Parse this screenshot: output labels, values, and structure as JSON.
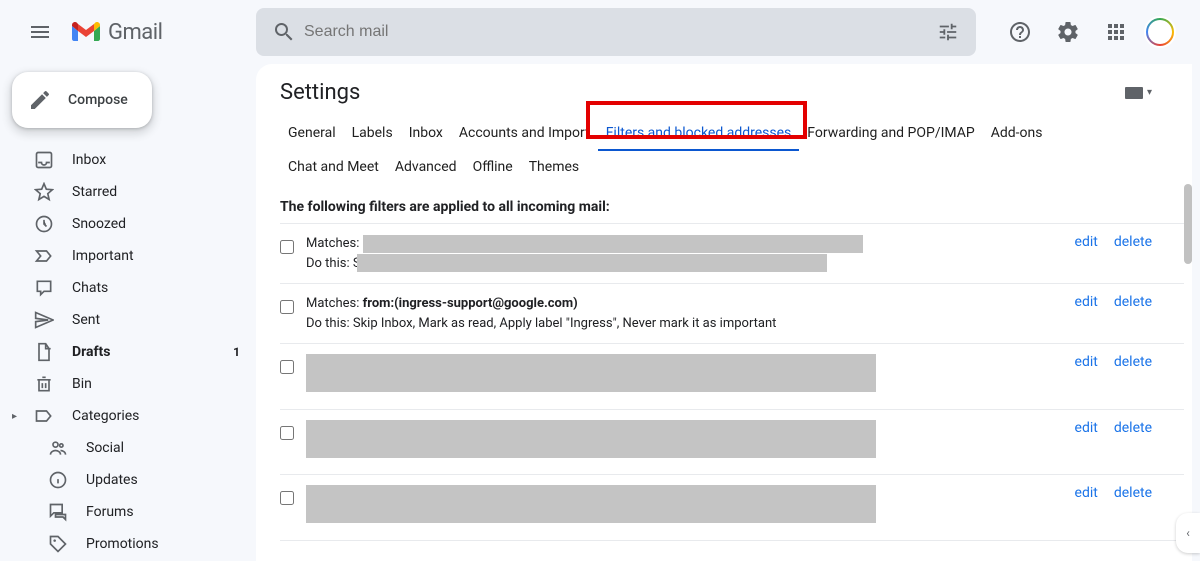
{
  "header": {
    "app_name": "Gmail",
    "search_placeholder": "Search mail"
  },
  "sidebar": {
    "compose_label": "Compose",
    "items": [
      {
        "icon": "inbox",
        "label": "Inbox",
        "bold": false
      },
      {
        "icon": "star",
        "label": "Starred",
        "bold": false
      },
      {
        "icon": "clock",
        "label": "Snoozed",
        "bold": false
      },
      {
        "icon": "important",
        "label": "Important",
        "bold": false
      },
      {
        "icon": "chat",
        "label": "Chats",
        "bold": false
      },
      {
        "icon": "send",
        "label": "Sent",
        "bold": false
      },
      {
        "icon": "draft",
        "label": "Drafts",
        "bold": true,
        "count": "1"
      },
      {
        "icon": "trash",
        "label": "Bin",
        "bold": false
      },
      {
        "icon": "label",
        "label": "Categories",
        "bold": false,
        "carrot": true
      },
      {
        "icon": "people",
        "label": "Social",
        "sub": true
      },
      {
        "icon": "info",
        "label": "Updates",
        "sub": true
      },
      {
        "icon": "forum",
        "label": "Forums",
        "sub": true
      },
      {
        "icon": "tag",
        "label": "Promotions",
        "sub": true
      }
    ]
  },
  "main": {
    "title": "Settings",
    "tabs": [
      {
        "label": "General",
        "active": false
      },
      {
        "label": "Labels",
        "active": false
      },
      {
        "label": "Inbox",
        "active": false
      },
      {
        "label": "Accounts and Import",
        "active": false
      },
      {
        "label": "Filters and blocked addresses",
        "active": true
      },
      {
        "label": "Forwarding and POP/IMAP",
        "active": false
      },
      {
        "label": "Add-ons",
        "active": false
      },
      {
        "label": "Chat and Meet",
        "active": false
      },
      {
        "label": "Advanced",
        "active": false
      },
      {
        "label": "Offline",
        "active": false
      },
      {
        "label": "Themes",
        "active": false
      }
    ],
    "intro": "The following filters are applied to all incoming mail:",
    "filters": [
      {
        "matches_label": "Matches:",
        "matches_value": "",
        "do_label": "Do this: S",
        "do_value": "",
        "redacted": true,
        "redact_w": 500,
        "redact_h": 38
      },
      {
        "matches_label": "Matches:",
        "matches_value": "from:(ingress-support@google.com)",
        "do_label": "Do this:",
        "do_value": "Skip Inbox, Mark as read, Apply label \"Ingress\", Never mark it as important",
        "redacted": false
      },
      {
        "redacted_full": true,
        "redact_w": 570,
        "redact_h": 38
      },
      {
        "redacted_full": true,
        "redact_w": 570,
        "redact_h": 38
      },
      {
        "redacted_full": true,
        "redact_w": 570,
        "redact_h": 38
      }
    ],
    "action_edit": "edit",
    "action_delete": "delete"
  }
}
